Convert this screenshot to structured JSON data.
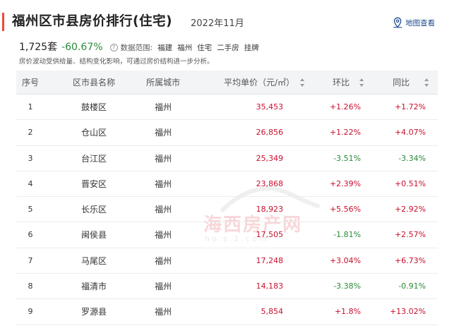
{
  "header": {
    "title": "福州区市县房价排行(住宅)",
    "period": "2022年11月",
    "map_link_label": "地图查看",
    "map_icon": "map-pin-icon"
  },
  "summary": {
    "count": "1,725套",
    "change": "-60.67%",
    "help_icon": "?",
    "scope_label": "数据范围:",
    "scope_items": [
      "福建",
      "福州",
      "住宅",
      "二手房",
      "挂牌"
    ]
  },
  "note": "房价波动受供给量、结构变化影响，可通过房价结构进一步分析。",
  "table": {
    "headers": {
      "index": "序号",
      "district": "区市县名称",
      "city": "所属城市",
      "price": "平均单价（元/㎡）",
      "mom": "环比",
      "yoy": "同比"
    },
    "rows": [
      {
        "index": "1",
        "district": "鼓楼区",
        "city": "福州",
        "price": "35,453",
        "mom": "+1.26%",
        "yoy": "+1.72%"
      },
      {
        "index": "2",
        "district": "仓山区",
        "city": "福州",
        "price": "26,856",
        "mom": "+1.22%",
        "yoy": "+4.07%"
      },
      {
        "index": "3",
        "district": "台江区",
        "city": "福州",
        "price": "25,349",
        "mom": "-3.51%",
        "yoy": "-3.34%"
      },
      {
        "index": "4",
        "district": "晋安区",
        "city": "福州",
        "price": "23,868",
        "mom": "+2.39%",
        "yoy": "+0.51%"
      },
      {
        "index": "5",
        "district": "长乐区",
        "city": "福州",
        "price": "18,923",
        "mom": "+5.56%",
        "yoy": "+2.92%"
      },
      {
        "index": "6",
        "district": "闽侯县",
        "city": "福州",
        "price": "17,505",
        "mom": "-1.81%",
        "yoy": "+2.57%"
      },
      {
        "index": "7",
        "district": "马尾区",
        "city": "福州",
        "price": "17,248",
        "mom": "+3.04%",
        "yoy": "+6.73%"
      },
      {
        "index": "8",
        "district": "福清市",
        "city": "福州",
        "price": "14,183",
        "mom": "-3.38%",
        "yoy": "-0.91%"
      },
      {
        "index": "9",
        "district": "罗源县",
        "city": "福州",
        "price": "5,854",
        "mom": "+1.8%",
        "yoy": "+13.02%"
      }
    ]
  },
  "watermark": {
    "cn": "海西房产网",
    "en": "ho.s.1.com"
  },
  "colors": {
    "accent": "#e84a3a",
    "up": "#c8102e",
    "down": "#2a8a3a",
    "link": "#1f4b8e"
  }
}
